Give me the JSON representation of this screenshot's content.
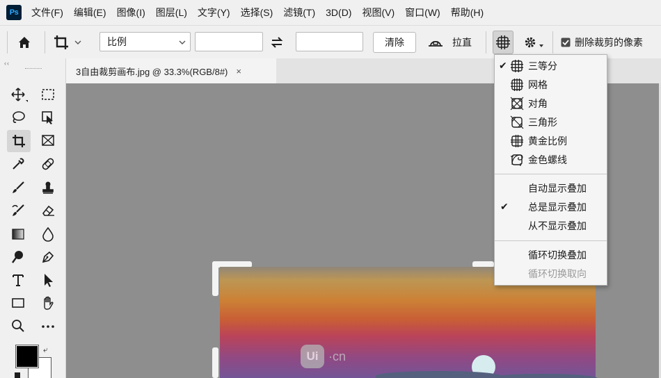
{
  "app": {
    "logo_text": "Ps"
  },
  "menubar": {
    "items": [
      "文件(F)",
      "编辑(E)",
      "图像(I)",
      "图层(L)",
      "文字(Y)",
      "选择(S)",
      "滤镜(T)",
      "3D(D)",
      "视图(V)",
      "窗口(W)",
      "帮助(H)"
    ]
  },
  "options": {
    "ratio_select_value": "比例",
    "width_value": "",
    "height_value": "",
    "clear_label": "清除",
    "straighten_label": "拉直",
    "delete_cropped_label": "删除裁剪的像素",
    "delete_cropped_checked": true
  },
  "document": {
    "tab_title": "3自由裁剪画布.jpg @ 33.3%(RGB/8#)",
    "close_glyph": "×"
  },
  "watermark": {
    "logo": "Ui",
    "text": "·cn"
  },
  "overlay_menu": {
    "items": [
      {
        "label": "三等分",
        "icon": "rule-of-thirds-icon",
        "checked": true
      },
      {
        "label": "网格",
        "icon": "grid-icon",
        "checked": false
      },
      {
        "label": "对角",
        "icon": "diagonal-icon",
        "checked": false
      },
      {
        "label": "三角形",
        "icon": "triangle-icon",
        "checked": false
      },
      {
        "label": "黄金比例",
        "icon": "golden-ratio-icon",
        "checked": false
      },
      {
        "label": "金色螺线",
        "icon": "golden-spiral-icon",
        "checked": false
      }
    ],
    "display_options": [
      {
        "label": "自动显示叠加",
        "checked": false
      },
      {
        "label": "总是显示叠加",
        "checked": true
      },
      {
        "label": "从不显示叠加",
        "checked": false
      }
    ],
    "cycle_overlay_label": "循环切换叠加",
    "cycle_orientation_label": "循环切换取向",
    "check_glyph": "✔"
  }
}
